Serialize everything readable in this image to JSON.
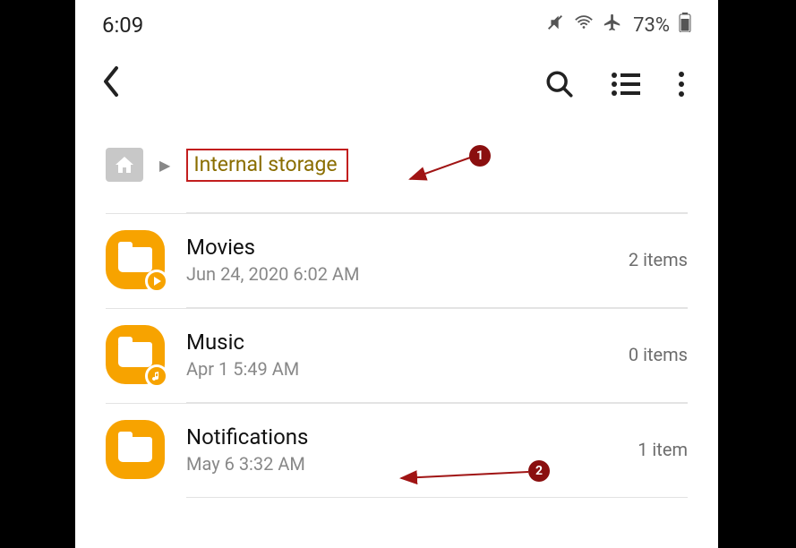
{
  "status": {
    "time": "6:09",
    "battery": "73%"
  },
  "breadcrumb": {
    "current": "Internal storage"
  },
  "folders": [
    {
      "name": "Movies",
      "date": "Jun 24, 2020 6:02 AM",
      "count": "2 items",
      "badge": "play"
    },
    {
      "name": "Music",
      "date": "Apr 1 5:49 AM",
      "count": "0 items",
      "badge": "music"
    },
    {
      "name": "Notifications",
      "date": "May 6 3:32 AM",
      "count": "1 item",
      "badge": ""
    }
  ],
  "annotations": [
    {
      "n": "1"
    },
    {
      "n": "2"
    }
  ]
}
